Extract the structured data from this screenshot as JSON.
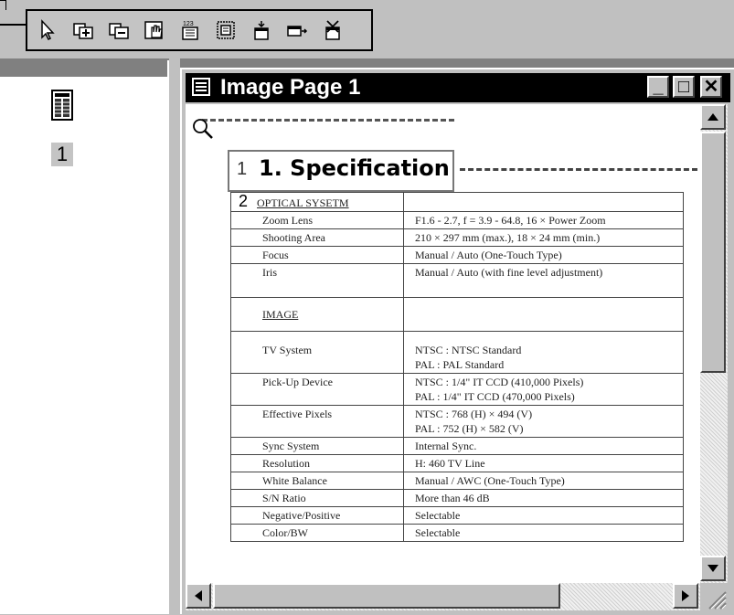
{
  "toolbar": {
    "buttons": [
      {
        "icon": "pointer-arrow-icon"
      },
      {
        "icon": "add-frame-icon"
      },
      {
        "icon": "remove-frame-icon"
      },
      {
        "icon": "hand-pan-icon"
      },
      {
        "icon": "numbering-icon",
        "label": "123"
      },
      {
        "icon": "zone-select-icon"
      },
      {
        "icon": "insert-down-icon"
      },
      {
        "icon": "insert-right-icon"
      },
      {
        "icon": "delete-zone-icon"
      }
    ]
  },
  "left_pane": {
    "pages": [
      {
        "number": "1"
      }
    ]
  },
  "window": {
    "title": "Image Page 1",
    "minimize_label": "_",
    "maximize_label": "□",
    "close_label": "✕"
  },
  "document": {
    "heading_number": "1",
    "heading_title": "1. Specification",
    "section2_number": "2",
    "section2_label": "OPTICAL SYSETM",
    "image_label": "IMAGE",
    "rows_optical": [
      {
        "label": "Zoom Lens",
        "value": "F1.6 - 2.7, f = 3.9 - 64.8, 16 × Power Zoom"
      },
      {
        "label": "Shooting Area",
        "value": "210 × 297 mm (max.), 18 × 24 mm (min.)"
      },
      {
        "label": "Focus",
        "value": "Manual / Auto (One-Touch Type)"
      },
      {
        "label": "Iris",
        "value": "Manual / Auto (with fine level adjustment)"
      }
    ],
    "rows_image": [
      {
        "label": "TV System",
        "value": "NTSC : NTSC Standard",
        "value2": "PAL : PAL Standard"
      },
      {
        "label": "Pick-Up Device",
        "value": "NTSC : 1/4\" IT CCD (410,000 Pixels)",
        "value2": "PAL : 1/4\" IT CCD (470,000 Pixels)"
      },
      {
        "label": "Effective Pixels",
        "value": "NTSC : 768 (H) × 494 (V)",
        "value2": "PAL : 752 (H) × 582 (V)"
      },
      {
        "label": "Sync System",
        "value": "Internal Sync."
      },
      {
        "label": "Resolution",
        "value": "H: 460 TV Line"
      },
      {
        "label": "White Balance",
        "value": "Manual / AWC (One-Touch Type)"
      },
      {
        "label": "S/N Ratio",
        "value": "More than 46 dB"
      },
      {
        "label": "Negative/Positive",
        "value": "Selectable"
      },
      {
        "label": "Color/BW",
        "value": "Selectable"
      }
    ]
  }
}
